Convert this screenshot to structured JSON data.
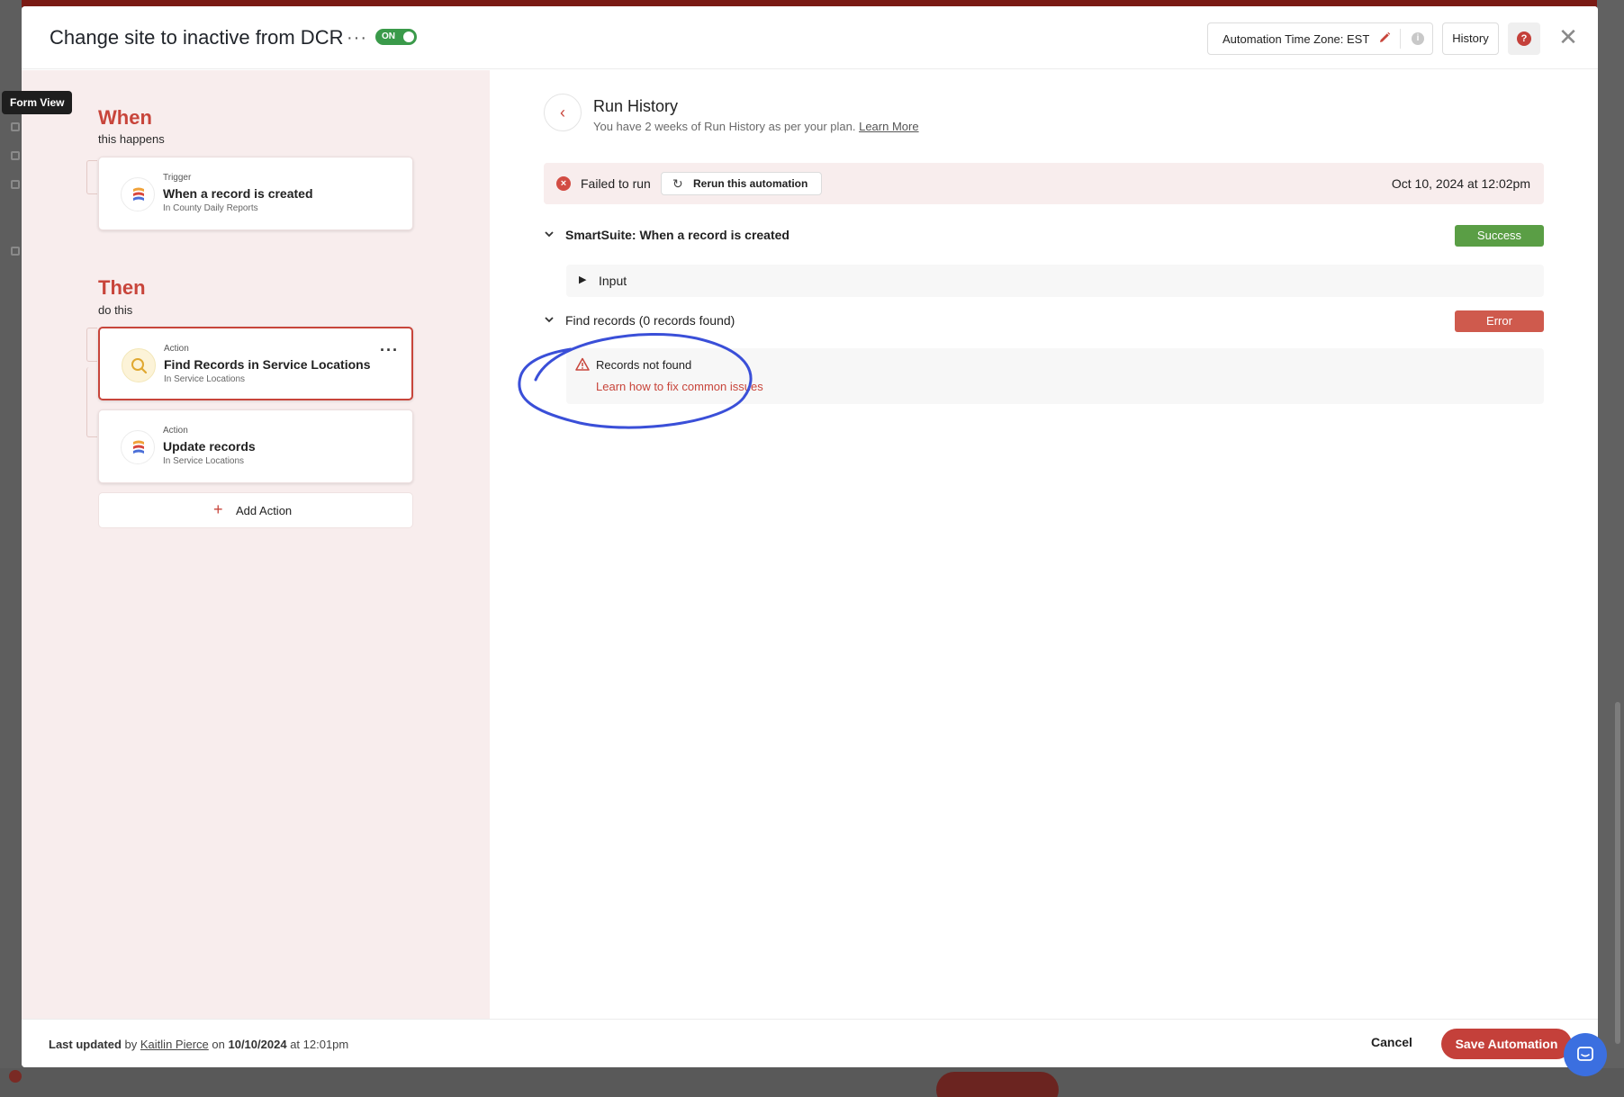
{
  "tooltip": {
    "text": "Form View"
  },
  "header": {
    "title": "Change site to inactive from DCR",
    "more": "···",
    "toggle_label": "ON",
    "timezone_label": "Automation Time Zone: EST",
    "history_label": "History",
    "help_glyph": "?",
    "close_glyph": "✕"
  },
  "when": {
    "title": "When",
    "subtitle": "this happens",
    "trigger": {
      "kind": "Trigger",
      "name": "When a record is created",
      "where": "In County Daily Reports",
      "icon": "smartsuite-logo-icon"
    }
  },
  "then": {
    "title": "Then",
    "subtitle": "do this",
    "actions": [
      {
        "kind": "Action",
        "name": "Find Records in Service Locations",
        "where": "In Service Locations",
        "icon": "search-icon"
      },
      {
        "kind": "Action",
        "name": "Update records",
        "where": "In Service Locations",
        "icon": "smartsuite-logo-icon"
      }
    ],
    "add_action_label": "Add Action",
    "add_action_glyph": "+",
    "card_more": "···"
  },
  "run_history": {
    "back_glyph": "‹",
    "title": "Run History",
    "subtitle": "You have 2 weeks of Run History as per your plan.",
    "learn_more": "Learn More",
    "status": {
      "error_glyph": "×",
      "text": "Failed to run",
      "rerun_glyph": "↻",
      "rerun_label": "Rerun this automation",
      "date": "Oct 10, 2024 at 12:02pm"
    },
    "steps": [
      {
        "chevron": "⌄",
        "name": "SmartSuite: When a record is created",
        "badge": "Success",
        "badge_color": "#5a9e45"
      },
      {
        "chevron": "⌄",
        "name": "Find records (0 records found)",
        "badge": "Error",
        "badge_color": "#cf5a4d"
      }
    ],
    "input": {
      "triangle": "▶",
      "label": "Input"
    },
    "error": {
      "title": "Records not found",
      "link": "Learn how to fix common issues"
    }
  },
  "footer": {
    "last_updated": "Last updated",
    "by": "by",
    "user": "Kaitlin Pierce",
    "on": "on",
    "date": "10/10/2024",
    "at": "at 12:01pm",
    "cancel_label": "Cancel",
    "save_label": "Save Automation"
  },
  "colors": {
    "accent": "#c8453b",
    "success": "#5a9e45",
    "error": "#cf5a4d",
    "annotation": "#3a4fd8",
    "chat": "#3b6fe0"
  }
}
